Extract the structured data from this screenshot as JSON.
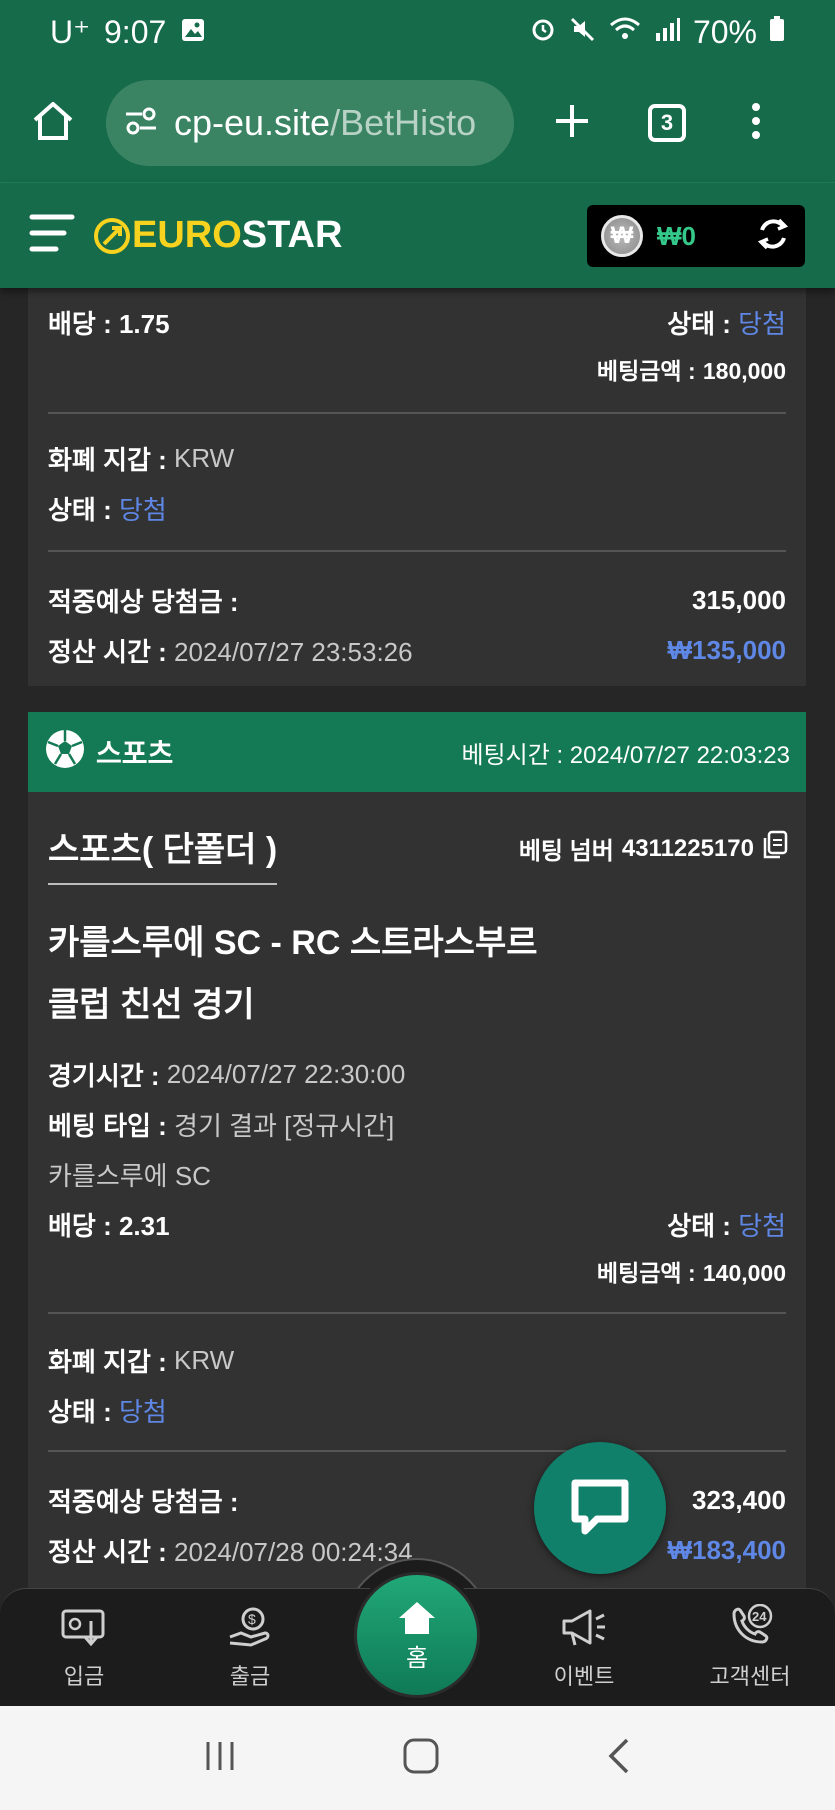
{
  "status_bar": {
    "carrier": "U⁺",
    "time": "9:07",
    "battery": "70%"
  },
  "browser": {
    "url_host": "cp-eu.site",
    "url_path": "/BetHisto",
    "tab_count": "3"
  },
  "site": {
    "logo_euro": "EURO",
    "logo_star": "STAR",
    "balance": "₩0"
  },
  "prev_card": {
    "odds_label": "배당 :",
    "odds": "1.75",
    "status_label": "상태 :",
    "status": "당첨",
    "bet_amount_label": "베팅금액 :",
    "bet_amount": "180,000",
    "wallet_label": "화폐 지갑 :",
    "wallet": "KRW",
    "status2_label": "상태 :",
    "status2": "당첨",
    "expected_label": "적중예상 당첨금 :",
    "expected": "315,000",
    "settle_label": "정산 시간 :",
    "settle_time": "2024/07/27 23:53:26",
    "profit": "₩135,000"
  },
  "card": {
    "category": "스포츠",
    "bet_time_label": "베팅시간 :",
    "bet_time": "2024/07/27 22:03:23",
    "subtitle": "스포츠( 단폴더 )",
    "bet_no_label": "베팅 넘버",
    "bet_no": "4311225170",
    "match_line1": "카를스루에 SC - RC 스트라스부르",
    "match_line2": "클럽 친선 경기",
    "game_time_label": "경기시간 :",
    "game_time": "2024/07/27 22:30:00",
    "bet_type_label": "베팅 타입 :",
    "bet_type": "경기 결과 [정규시간]",
    "pick": "카를스루에 SC",
    "odds_label": "배당 :",
    "odds": "2.31",
    "status_label": "상태 :",
    "status": "당첨",
    "bet_amount_label": "베팅금액 :",
    "bet_amount": "140,000",
    "wallet_label": "화폐 지갑 :",
    "wallet": "KRW",
    "status2_label": "상태 :",
    "status2": "당첨",
    "expected_label": "적중예상 당첨금 :",
    "expected": "323,400",
    "settle_label": "정산 시간 :",
    "settle_time": "2024/07/28 00:24:34",
    "profit": "₩183,400"
  },
  "bottom_nav": {
    "deposit": "입금",
    "withdraw": "출금",
    "home": "홈",
    "event": "이벤트",
    "support": "고객센터"
  },
  "colors": {
    "header_green": "#166b4b",
    "card_head_green": "#137a55",
    "accent_blue": "#5f87e6",
    "logo_yellow": "#f7d21e"
  }
}
